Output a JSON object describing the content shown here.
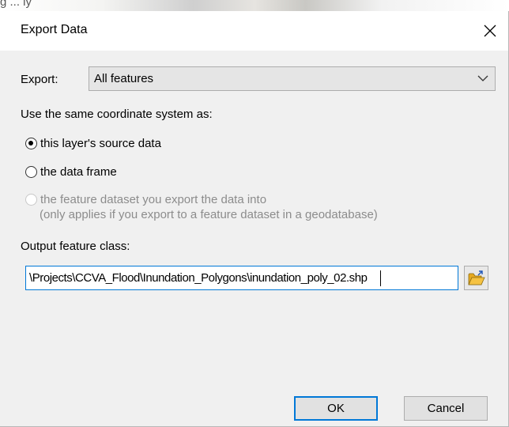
{
  "background": {
    "text": "g     ...   ly"
  },
  "window": {
    "title": "Export Data",
    "close_label": "×"
  },
  "export": {
    "label": "Export:",
    "selected": "All features"
  },
  "coordinate": {
    "heading": "Use the same coordinate system as:",
    "options": [
      {
        "label": "this layer's source data",
        "checked": true,
        "enabled": true
      },
      {
        "label": "the data frame",
        "checked": false,
        "enabled": true
      },
      {
        "label": "the feature dataset you export the data into",
        "sublabel": "(only applies if you export to a feature dataset in a geodatabase)",
        "checked": false,
        "enabled": false
      }
    ]
  },
  "output": {
    "label": "Output feature class:",
    "value": "\\Projects\\CCVA_Flood\\Inundation_Polygons\\inundation_poly_02.shp"
  },
  "buttons": {
    "ok": "OK",
    "cancel": "Cancel"
  },
  "colors": {
    "accent": "#0078d7",
    "dialog_bg": "#f0f0f0",
    "folder": "#f5c242"
  },
  "icons": {
    "close": "close-icon",
    "dropdown": "chevron-down-icon",
    "browse": "open-folder-icon"
  }
}
